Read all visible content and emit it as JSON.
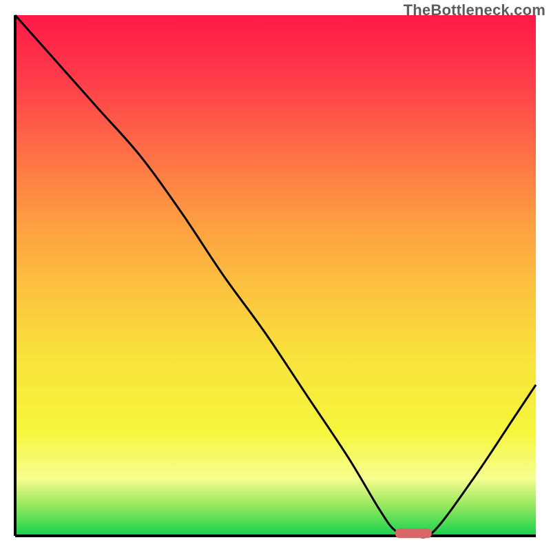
{
  "watermark": "TheBottleneck.com",
  "colors": {
    "curve": "#000000",
    "axis": "#000000",
    "marker": "#d86767"
  },
  "chart_data": {
    "type": "line",
    "title": "",
    "xlabel": "",
    "ylabel": "",
    "xlim": [
      0,
      100
    ],
    "ylim": [
      0,
      100
    ],
    "grid": false,
    "legend": false,
    "background": "gradient red→yellow→green (top→bottom)",
    "series": [
      {
        "name": "bottleneck-curve",
        "x": [
          0,
          8,
          16,
          24,
          32,
          40,
          48,
          56,
          64,
          70,
          73,
          76,
          80,
          88,
          96,
          100
        ],
        "y": [
          100,
          91,
          82,
          73,
          62,
          50,
          39,
          27,
          15,
          5,
          1,
          0.5,
          0.5,
          11,
          23,
          29
        ]
      }
    ],
    "marker": {
      "x_range": [
        73,
        80
      ],
      "y": 0.5,
      "shape": "rounded-bar"
    }
  }
}
